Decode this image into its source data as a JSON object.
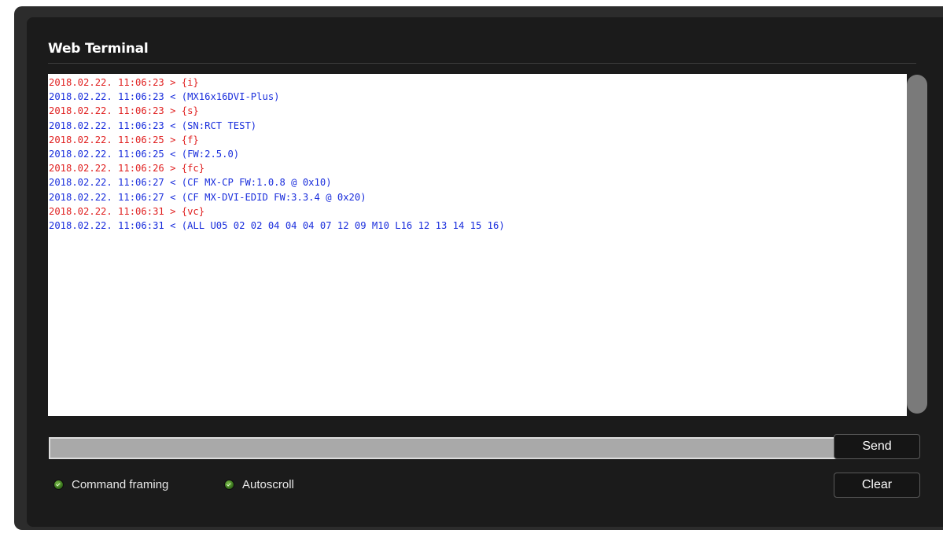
{
  "window": {
    "title": "Web Terminal"
  },
  "terminal": {
    "lines": [
      {
        "text": "2018.02.22. 11:06:23 > {i}",
        "direction": "out"
      },
      {
        "text": "2018.02.22. 11:06:23 < (MX16x16DVI-Plus)",
        "direction": "in"
      },
      {
        "text": "2018.02.22. 11:06:23 > {s}",
        "direction": "out"
      },
      {
        "text": "2018.02.22. 11:06:23 < (SN:RCT TEST)",
        "direction": "in"
      },
      {
        "text": "2018.02.22. 11:06:25 > {f}",
        "direction": "out"
      },
      {
        "text": "2018.02.22. 11:06:25 < (FW:2.5.0)",
        "direction": "in"
      },
      {
        "text": "2018.02.22. 11:06:26 > {fc}",
        "direction": "out"
      },
      {
        "text": "2018.02.22. 11:06:27 < (CF MX-CP FW:1.0.8 @ 0x10)",
        "direction": "in"
      },
      {
        "text": "2018.02.22. 11:06:27 < (CF MX-DVI-EDID FW:3.3.4 @ 0x20)",
        "direction": "in"
      },
      {
        "text": "2018.02.22. 11:06:31 > {vc}",
        "direction": "out"
      },
      {
        "text": "2018.02.22. 11:06:31 < (ALL U05 02 02 04 04 04 07 12 09 M10 L16 12 13 14 15 16)",
        "direction": "in"
      }
    ]
  },
  "command": {
    "value": "",
    "placeholder": ""
  },
  "buttons": {
    "send_label": "Send",
    "clear_label": "Clear"
  },
  "options": {
    "command_framing_label": "Command framing",
    "command_framing_checked": true,
    "autoscroll_label": "Autoscroll",
    "autoscroll_checked": true
  },
  "colors": {
    "outgoing": "#e02020",
    "incoming": "#1a2edc",
    "check_active": "#5a9e2f"
  }
}
